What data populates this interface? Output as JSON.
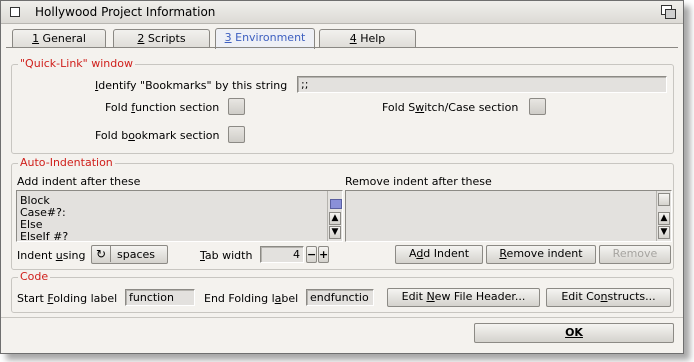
{
  "window": {
    "title": "Hollywood Project Information"
  },
  "tabs": [
    {
      "pre": "",
      "key": "1",
      "post": " General"
    },
    {
      "pre": "",
      "key": "2",
      "post": " Scripts"
    },
    {
      "pre": "",
      "key": "3",
      "post": " Environment"
    },
    {
      "pre": "",
      "key": "4",
      "post": " Help"
    }
  ],
  "quicklink": {
    "legend": "\"Quick-Link\" window",
    "identify_pre": "",
    "identify_key": "I",
    "identify_post": "dentify \"Bookmarks\" by this string",
    "identify_value": ";;",
    "fold_function_pre": "Fold ",
    "fold_function_key": "f",
    "fold_function_post": "unction section",
    "fold_switch_pre": "Fold S",
    "fold_switch_key": "w",
    "fold_switch_post": "itch/Case section",
    "fold_bookmark_pre": "Fold b",
    "fold_bookmark_key": "o",
    "fold_bookmark_post": "okmark section"
  },
  "autoindent": {
    "legend": "Auto-Indentation",
    "add_header": "Add indent after these",
    "remove_header": "Remove indent after these",
    "add_items": [
      "Block",
      "Case#?:",
      "Else",
      "ElseIf #?"
    ],
    "indent_using_pre": "Indent ",
    "indent_using_key": "u",
    "indent_using_post": "sing",
    "indent_mode": "spaces",
    "tab_width_pre": "",
    "tab_width_key": "T",
    "tab_width_post": "ab width",
    "tab_width_value": "4",
    "minus": "−",
    "plus": "+",
    "add_btn_pre": "A",
    "add_btn_key": "d",
    "add_btn_post": "d Indent",
    "remove_btn_pre": "",
    "remove_btn_key": "R",
    "remove_btn_post": "emove indent",
    "remove_disabled": "Remove"
  },
  "code": {
    "legend": "Code",
    "start_pre": "Start ",
    "start_key": "F",
    "start_post": "olding label",
    "start_value": "function",
    "end_pre": "End Folding l",
    "end_key": "a",
    "end_post": "bel",
    "end_value": "endfunctio",
    "edit_header_pre": "Edit ",
    "edit_header_key": "N",
    "edit_header_post": "ew File Header...",
    "edit_constructs_pre": "Edit Co",
    "edit_constructs_key": "n",
    "edit_constructs_post": "structs..."
  },
  "footer": {
    "ok": "OK"
  },
  "icons": {
    "cycle": "cycle-icon",
    "up": "arrow-up-icon",
    "down": "arrow-down-icon"
  }
}
